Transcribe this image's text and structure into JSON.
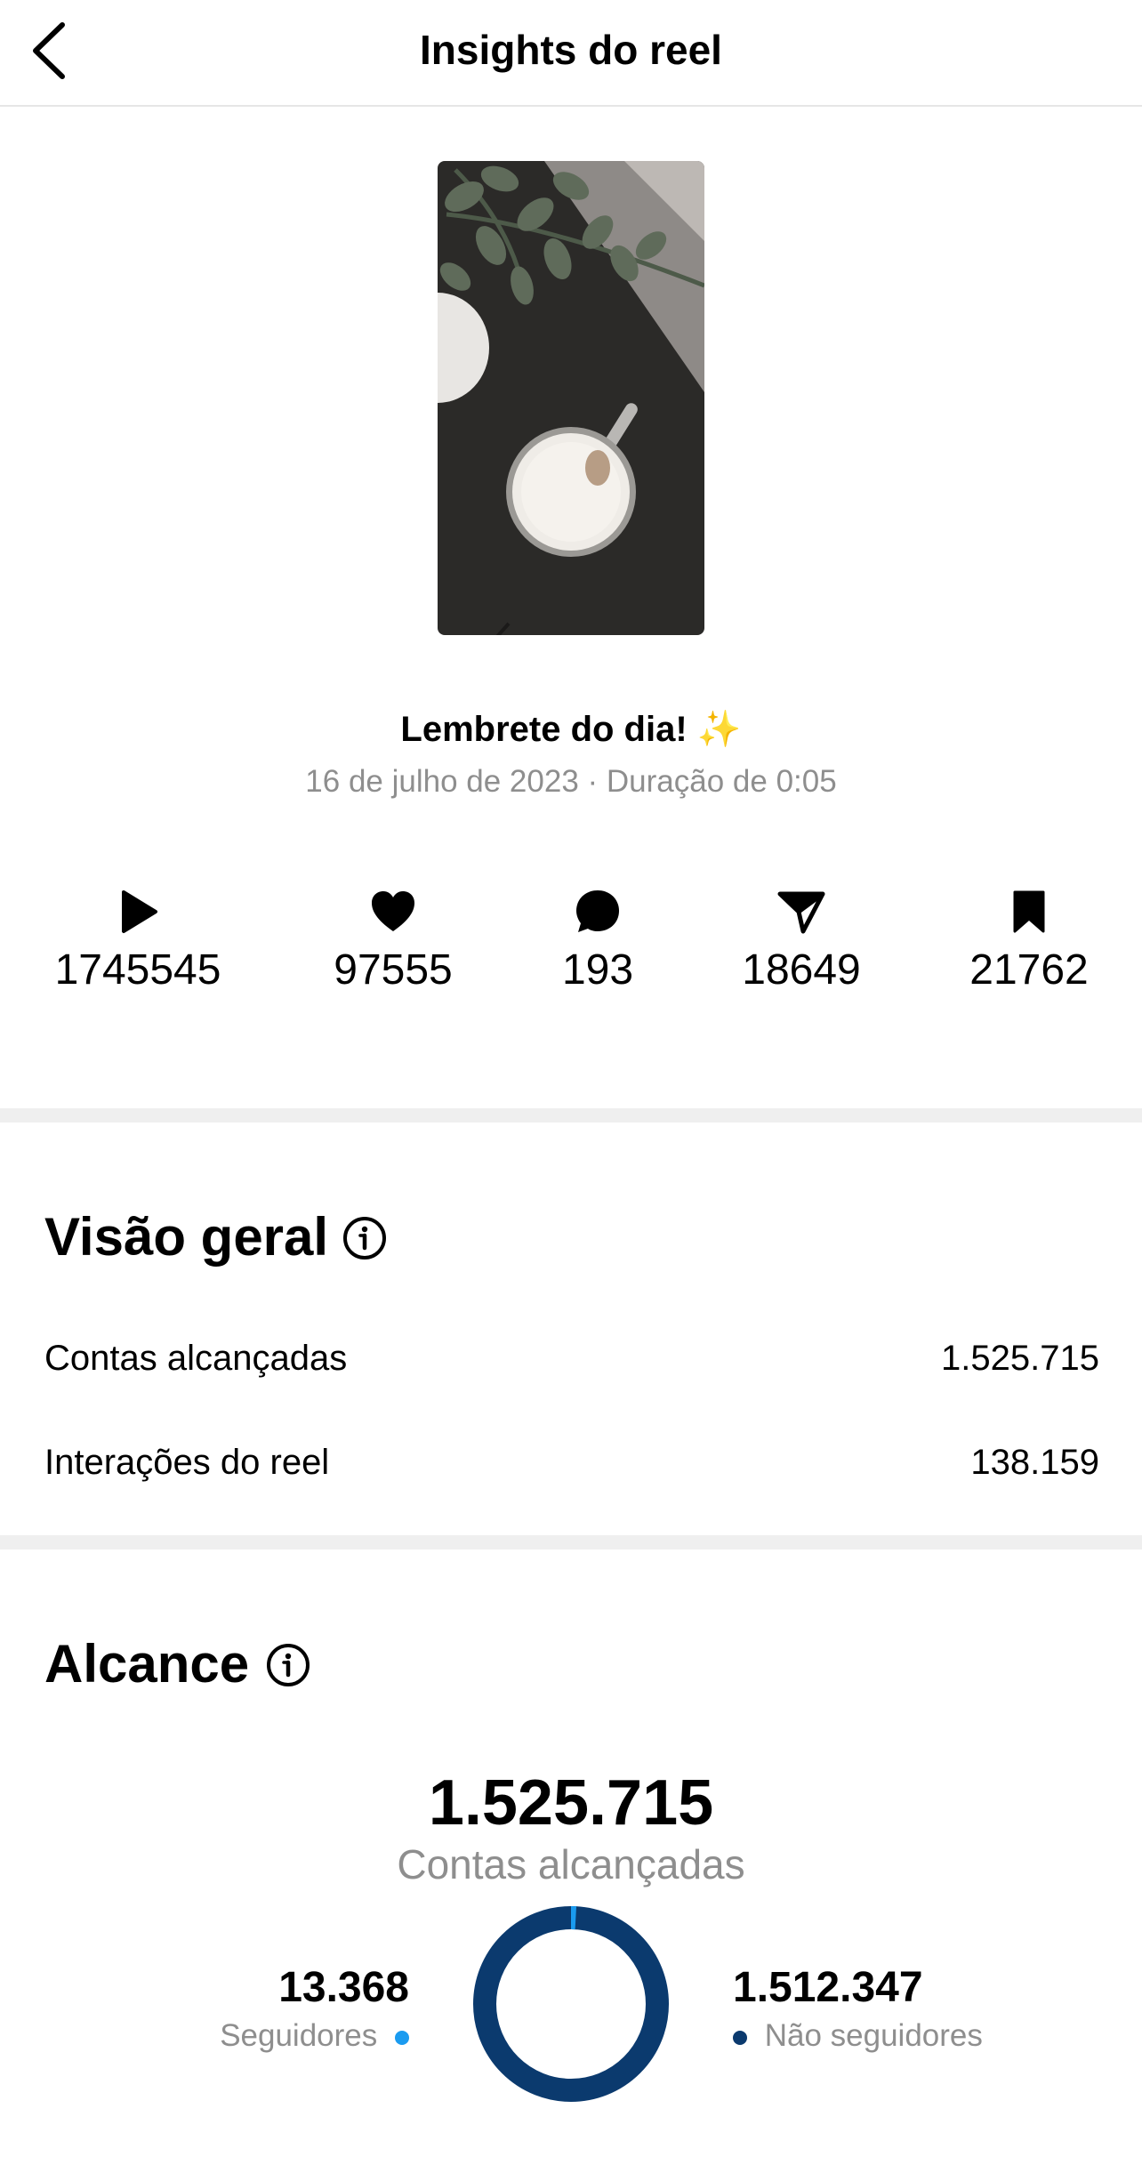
{
  "header": {
    "title": "Insights do reel"
  },
  "reel": {
    "title": "Lembrete do dia!",
    "title_emoji": "✨",
    "meta": "16 de julho de 2023 · Duração de 0:05"
  },
  "metrics": [
    {
      "icon": "play-icon",
      "value": "1745545"
    },
    {
      "icon": "heart-icon",
      "value": "97555"
    },
    {
      "icon": "comment-icon",
      "value": "193"
    },
    {
      "icon": "share-icon",
      "value": "18649"
    },
    {
      "icon": "bookmark-icon",
      "value": "21762"
    }
  ],
  "overview": {
    "title": "Visão geral",
    "rows": [
      {
        "label": "Contas alcançadas",
        "value": "1.525.715"
      },
      {
        "label": "Interações do reel",
        "value": "138.159"
      }
    ]
  },
  "reach": {
    "title": "Alcance",
    "total": "1.525.715",
    "total_label": "Contas alcançadas",
    "followers": {
      "value": "13.368",
      "label": "Seguidores",
      "fraction": 0.0088,
      "color": "#1a9bf0"
    },
    "non_followers": {
      "value": "1.512.347",
      "label": "Não seguidores",
      "fraction": 0.9912,
      "color": "#0b3a6e"
    }
  }
}
